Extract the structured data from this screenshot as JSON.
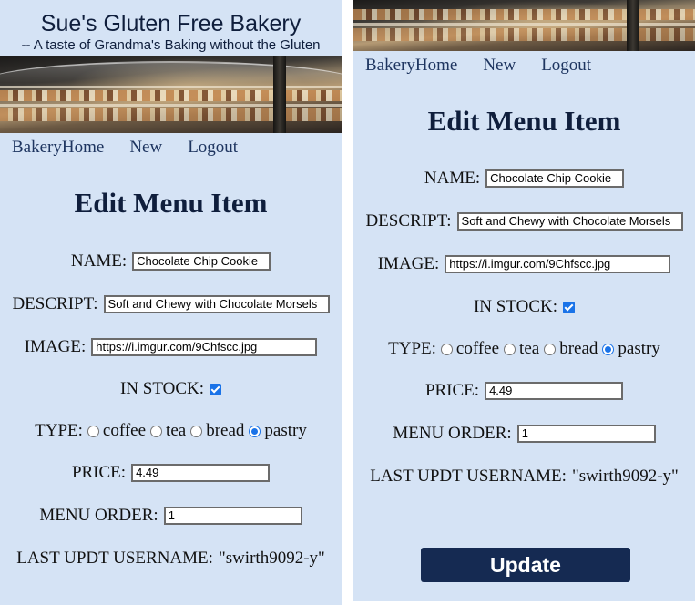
{
  "brand": {
    "title": "Sue's Gluten Free Bakery",
    "tagline": "-- A taste of Grandma's Baking without the Gluten"
  },
  "banner": {
    "description_icon": "bakery-display-case-image"
  },
  "nav": {
    "home": "BakeryHome",
    "new": "New",
    "logout": "Logout"
  },
  "form": {
    "heading": "Edit Menu Item",
    "name_label": "NAME:",
    "name_value": "Chocolate Chip Cookie",
    "descript_label": "DESCRIPT:",
    "descript_value": "Soft and Chewy with Chocolate Morsels",
    "image_label": "IMAGE:",
    "image_value": "https://i.imgur.com/9Chfscc.jpg",
    "in_stock_label": "IN STOCK:",
    "in_stock_checked": true,
    "type_label": "TYPE:",
    "type_options": [
      "coffee",
      "tea",
      "bread",
      "pastry"
    ],
    "type_selected": "pastry",
    "price_label": "PRICE:",
    "price_value": "4.49",
    "menu_order_label": "MENU ORDER:",
    "menu_order_value": "1",
    "last_updt_label": "LAST UPDT USERNAME:",
    "last_updt_value": "\"swirth9092-y\""
  },
  "actions": {
    "update_label": "Update"
  },
  "colors": {
    "page_bg": "#d5e3f5",
    "heading": "#0f1e3c",
    "nav_link": "#1e3560",
    "button_bg": "#152a52",
    "checkbox_accent": "#1a73e8"
  }
}
